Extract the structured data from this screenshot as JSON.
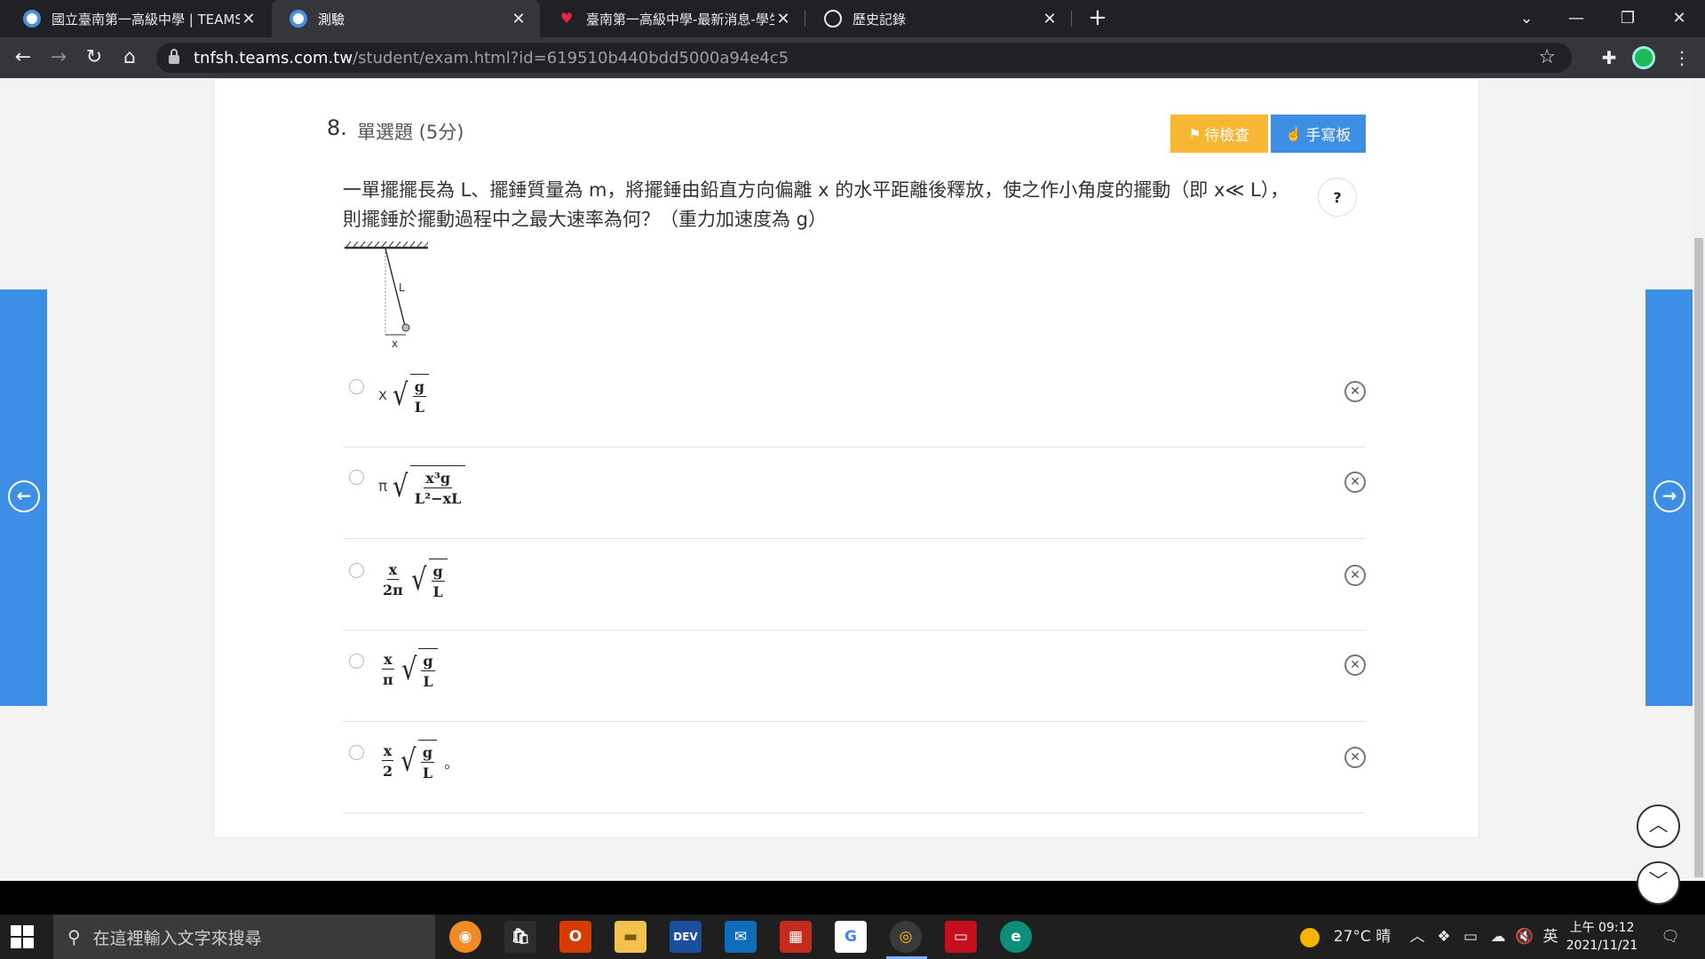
{
  "browser": {
    "tabs": [
      {
        "title": "國立臺南第一高級中學 | TEAMS",
        "active": false
      },
      {
        "title": "測驗",
        "active": true
      },
      {
        "title": "臺南第一高級中學-最新消息-學生",
        "active": false
      },
      {
        "title": "歷史記錄",
        "active": false
      }
    ],
    "url_host": "tnfsh.teams.com.tw",
    "url_path": "/student/exam.html?id=619510b440bdd5000a94e4c5"
  },
  "question": {
    "number": "8.",
    "type_label": "單選題 (5分)",
    "pending_label": "待檢查",
    "pad_label": "手寫板",
    "help_label": "?",
    "text": "一單擺擺長為 L、擺錘質量為 m，將擺錘由鉛直方向偏離 x 的水平距離後釋放，使之作小角度的擺動（即 x≪ L），則擺錘於擺動過程中之最大速率為何？（重力加速度為 g）",
    "diagram": {
      "length_label": "L",
      "offset_label": "x"
    }
  },
  "options": [
    {
      "prefix": "x",
      "rad_num": "g",
      "rad_den": "L"
    },
    {
      "prefix": "π",
      "rad_num": "x³g",
      "rad_den": "L²−xL"
    },
    {
      "coef_num": "x",
      "coef_den": "2π",
      "rad_num": "g",
      "rad_den": "L"
    },
    {
      "coef_num": "x",
      "coef_den": "π",
      "rad_num": "g",
      "rad_den": "L"
    },
    {
      "coef_num": "x",
      "coef_den": "2",
      "rad_num": "g",
      "rad_den": "L",
      "suffix": "。"
    }
  ],
  "taskbar": {
    "search_placeholder": "在這裡輸入文字來搜尋",
    "weather": "27°C 晴",
    "ime": "英",
    "time": "上午 09:12",
    "date": "2021/11/21"
  },
  "colors": {
    "accent_blue": "#3d8fe6",
    "pending_orange": "#f7b733"
  }
}
